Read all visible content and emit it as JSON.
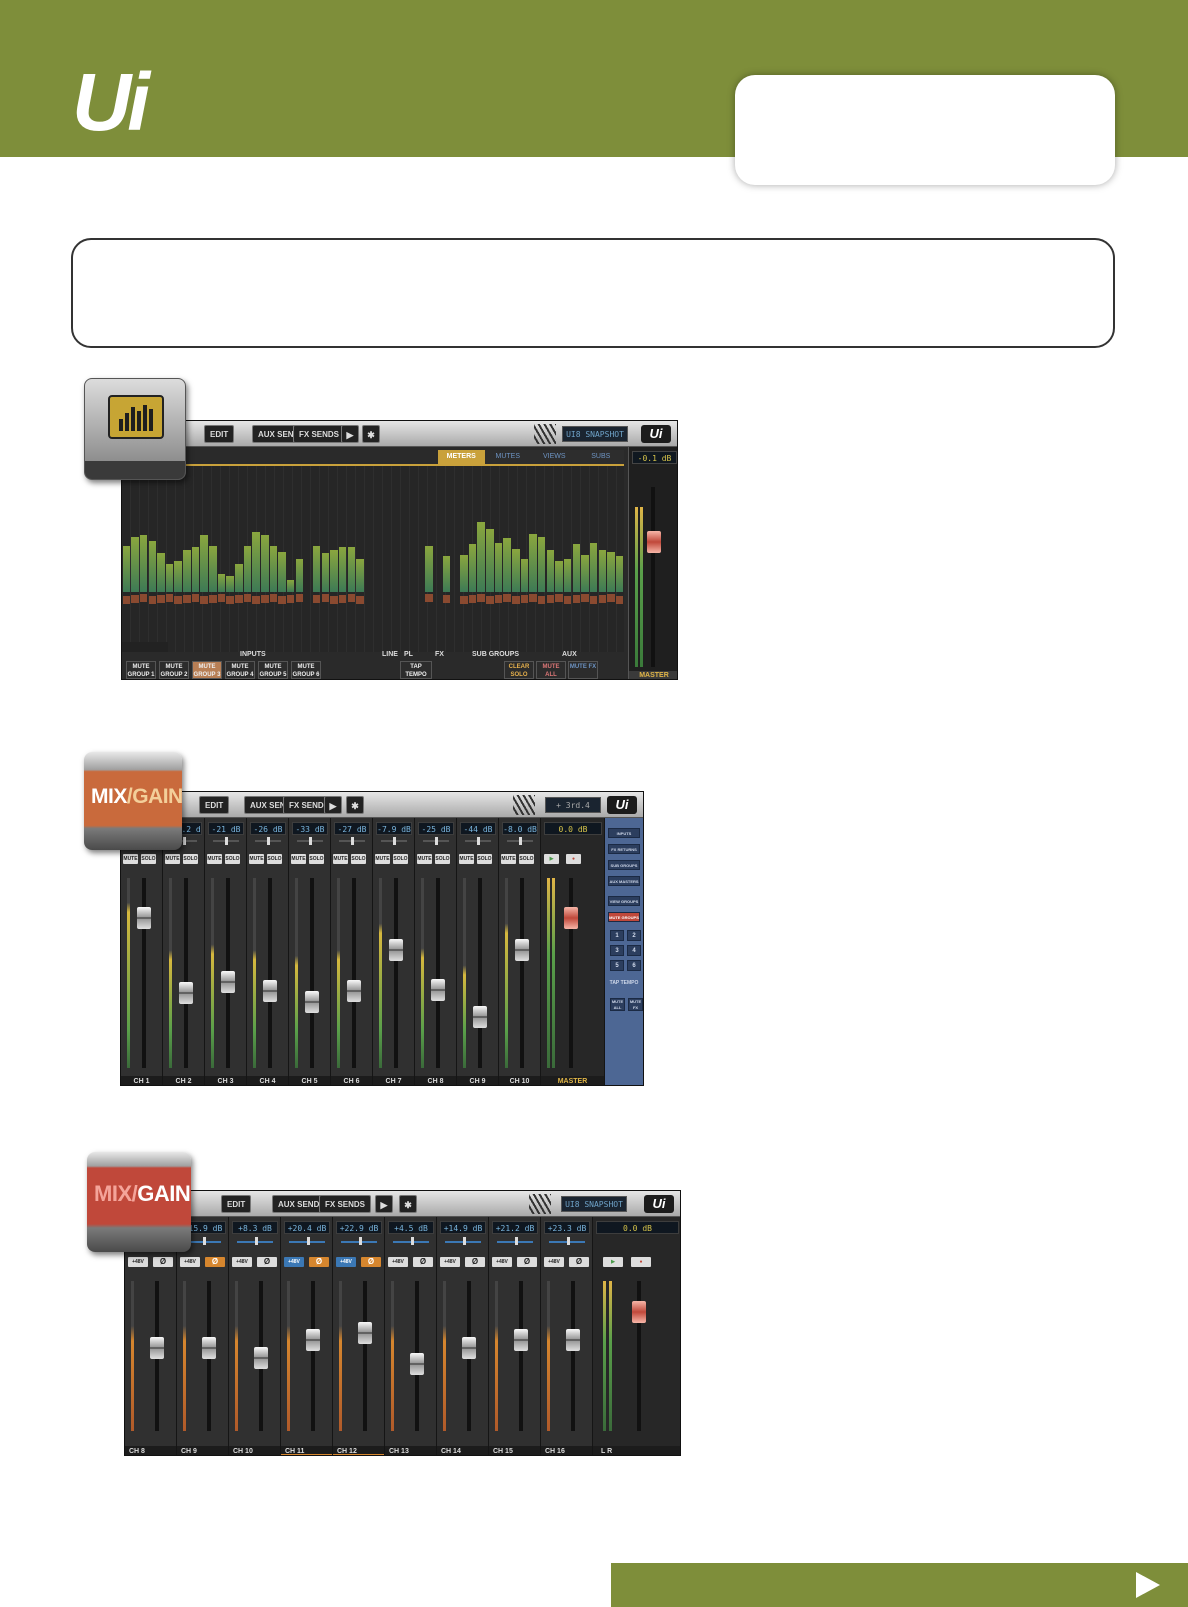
{
  "brand": {
    "logo": "Ui"
  },
  "colors": {
    "brand_green": "#7e8e3a",
    "mix_orange": "#c96a3c",
    "mix_red": "#c0483a",
    "meter_gold": "#c9a13b"
  },
  "toolbar": {
    "edit": "EDIT",
    "aux": "AUX SENDS",
    "fx": "FX SENDS",
    "play_icon": "play-icon",
    "gear_icon": "gear-icon",
    "snapshot": "UI8 SNAPSHOT",
    "logo": "Ui"
  },
  "overlay": {
    "mix": "MIX",
    "slash": "/",
    "gain": "GAIN"
  },
  "meters": {
    "tabs": [
      "METERS",
      "MUTES",
      "VIEWS",
      "SUBS"
    ],
    "master_db": "-0.1 dB",
    "master_label": "MASTER",
    "sections": [
      "INPUTS",
      "LINE",
      "PL",
      "FX",
      "SUB GROUPS",
      "AUX"
    ],
    "mute_groups": [
      "MUTE GROUP 1",
      "MUTE GROUP 2",
      "MUTE GROUP 3",
      "MUTE GROUP 4",
      "MUTE GROUP 5",
      "MUTE GROUP 6"
    ],
    "tap_tempo": "TAP TEMPO",
    "clear_solo": "CLEAR SOLO",
    "mute_all": "MUTE ALL",
    "mute_fx": "MUTE FX",
    "levels": [
      0.31,
      0.37,
      0.38,
      0.34,
      0.26,
      0.19,
      0.21,
      0.28,
      0.3,
      0.38,
      0.31,
      0.12,
      0.11,
      0.19,
      0.31,
      0.4,
      0.38,
      0.31,
      0.27,
      0.08,
      0.22,
      0.0,
      0.31,
      0.26,
      0.28,
      0.3,
      0.3,
      0.22,
      0.0,
      0.0,
      0.0,
      0.0,
      0.0,
      0.0,
      0.0,
      0.31,
      0.0,
      0.24,
      0.0,
      0.25,
      0.32,
      0.47,
      0.42,
      0.33,
      0.36,
      0.29,
      0.22,
      0.39,
      0.37,
      0.28,
      0.21,
      0.22,
      0.32,
      0.25,
      0.33,
      0.28,
      0.27,
      0.24
    ]
  },
  "mix": {
    "channels": [
      {
        "db": "-0.0 dB",
        "label": "CH 1",
        "fader": 0.78
      },
      {
        "db": "-17.2 dB",
        "label": "CH 2",
        "fader": 0.36
      },
      {
        "db": "-21 dB",
        "label": "CH 3",
        "fader": 0.42
      },
      {
        "db": "-26 dB",
        "label": "CH 4",
        "fader": 0.37
      },
      {
        "db": "-33 dB",
        "label": "CH 5",
        "fader": 0.31
      },
      {
        "db": "-27 dB",
        "label": "CH 6",
        "fader": 0.37
      },
      {
        "db": "-7.9 dB",
        "label": "CH 7",
        "fader": 0.6
      },
      {
        "db": "-25 dB",
        "label": "CH 8",
        "fader": 0.38
      },
      {
        "db": "-44 dB",
        "label": "CH 9",
        "fader": 0.23
      },
      {
        "db": "-8.0 dB",
        "label": "CH 10",
        "fader": 0.6
      }
    ],
    "master": {
      "db": "0.0 dB",
      "label": "MASTER",
      "fader": 0.78
    },
    "mute": "MUTE",
    "solo": "SOLO",
    "side": [
      "INPUTS",
      "FX RETURNS",
      "SUB GROUPS",
      "AUX MASTERS",
      "VIEW GROUPS",
      "MUTE GROUPS"
    ],
    "side_nums": [
      "1",
      "2",
      "3",
      "4",
      "5",
      "6"
    ],
    "side_tap": "TAP TEMPO",
    "side_mute_all": "MUTE ALL",
    "side_mute_fx": "MUTE FX",
    "snapshot": "+ 3rd.4"
  },
  "gain": {
    "channels": [
      {
        "db": "-4.1 dB",
        "label": "CH 8",
        "fader": 0.52
      },
      {
        "db": "+15.9 dB",
        "label": "CH 9",
        "fader": 0.52
      },
      {
        "db": "+8.3 dB",
        "label": "CH 10",
        "fader": 0.45
      },
      {
        "db": "+20.4 dB",
        "label": "CH 11",
        "fader": 0.58
      },
      {
        "db": "+22.9 dB",
        "label": "CH 12",
        "fader": 0.63
      },
      {
        "db": "+4.5 dB",
        "label": "CH 13",
        "fader": 0.41
      },
      {
        "db": "+14.9 dB",
        "label": "CH 14",
        "fader": 0.52
      },
      {
        "db": "+21.2 dB",
        "label": "CH 15",
        "fader": 0.58
      },
      {
        "db": "+23.3 dB",
        "label": "CH 16",
        "fader": 0.58
      }
    ],
    "master": {
      "db": "0.0 dB",
      "fader": 0.78
    },
    "phantom": "+48V",
    "phase": "Ø",
    "lr": "L R"
  }
}
